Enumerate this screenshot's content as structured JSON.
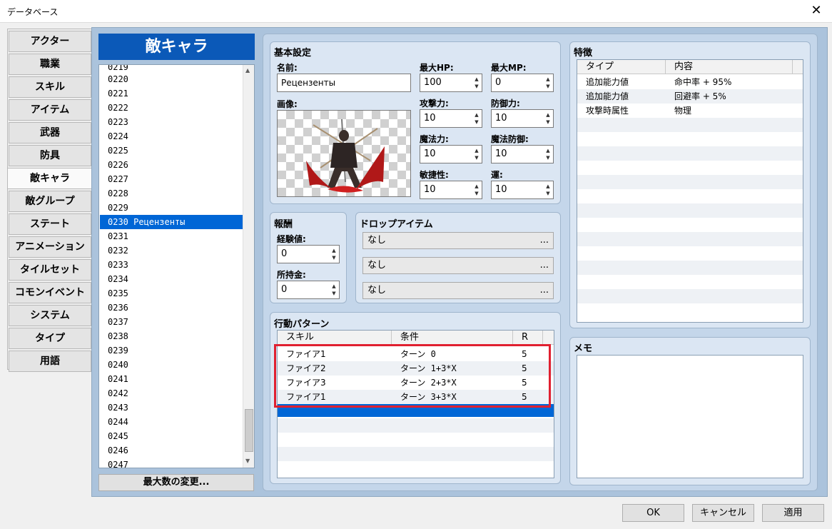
{
  "window": {
    "title": "データベース",
    "close_glyph": "✕"
  },
  "nav": [
    "アクター",
    "職業",
    "スキル",
    "アイテム",
    "武器",
    "防具",
    "敵キャラ",
    "敵グループ",
    "ステート",
    "アニメーション",
    "タイルセット",
    "コモンイベント",
    "システム",
    "タイプ",
    "用語"
  ],
  "nav_selected": 6,
  "list": {
    "header": "敵キャラ",
    "items": [
      "0219",
      "0220",
      "0221",
      "0222",
      "0223",
      "0224",
      "0225",
      "0226",
      "0227",
      "0228",
      "0229",
      "0230 Рецензенты",
      "0231",
      "0232",
      "0233",
      "0234",
      "0235",
      "0236",
      "0237",
      "0238",
      "0239",
      "0240",
      "0241",
      "0242",
      "0243",
      "0244",
      "0245",
      "0246",
      "0247"
    ],
    "selected": 11,
    "max_button": "最大数の変更..."
  },
  "basic": {
    "title": "基本設定",
    "name_label": "名前:",
    "name_value": "Рецензенты",
    "image_label": "画像:",
    "maxhp_label": "最大HP:",
    "maxhp": "100",
    "maxmp_label": "最大MP:",
    "maxmp": "0",
    "atk_label": "攻撃力:",
    "atk": "10",
    "def_label": "防御力:",
    "def": "10",
    "mat_label": "魔法力:",
    "mat": "10",
    "mdf_label": "魔法防御:",
    "mdf": "10",
    "agi_label": "敏捷性:",
    "agi": "10",
    "luk_label": "運:",
    "luk": "10"
  },
  "reward": {
    "title": "報酬",
    "exp_label": "経験値:",
    "exp": "0",
    "gold_label": "所持金:",
    "gold": "0"
  },
  "drops": {
    "title": "ドロップアイテム",
    "items": [
      "なし",
      "なし",
      "なし"
    ],
    "dots": "..."
  },
  "actions": {
    "title": "行動パターン",
    "headers": [
      "スキル",
      "条件",
      "R"
    ],
    "rows": [
      {
        "skill": "ファイア1",
        "cond": "ターン 0",
        "r": "5"
      },
      {
        "skill": "ファイア2",
        "cond": "ターン 1+3*X",
        "r": "5"
      },
      {
        "skill": "ファイア3",
        "cond": "ターン 2+3*X",
        "r": "5"
      },
      {
        "skill": "ファイア1",
        "cond": "ターン 3+3*X",
        "r": "5"
      }
    ]
  },
  "traits": {
    "title": "特徴",
    "headers": [
      "タイプ",
      "内容"
    ],
    "rows": [
      {
        "type": "追加能力値",
        "content": "命中率 + 95%"
      },
      {
        "type": "追加能力値",
        "content": "回避率 + 5%"
      },
      {
        "type": "攻撃時属性",
        "content": "物理"
      }
    ]
  },
  "memo": {
    "title": "メモ"
  },
  "buttons": {
    "ok": "OK",
    "cancel": "キャンセル",
    "apply": "適用"
  },
  "colors": {
    "header_blue": "#0b59b8",
    "selection": "#0066d6",
    "highlight_box": "#e02030",
    "workspace": "#abc3dc"
  }
}
